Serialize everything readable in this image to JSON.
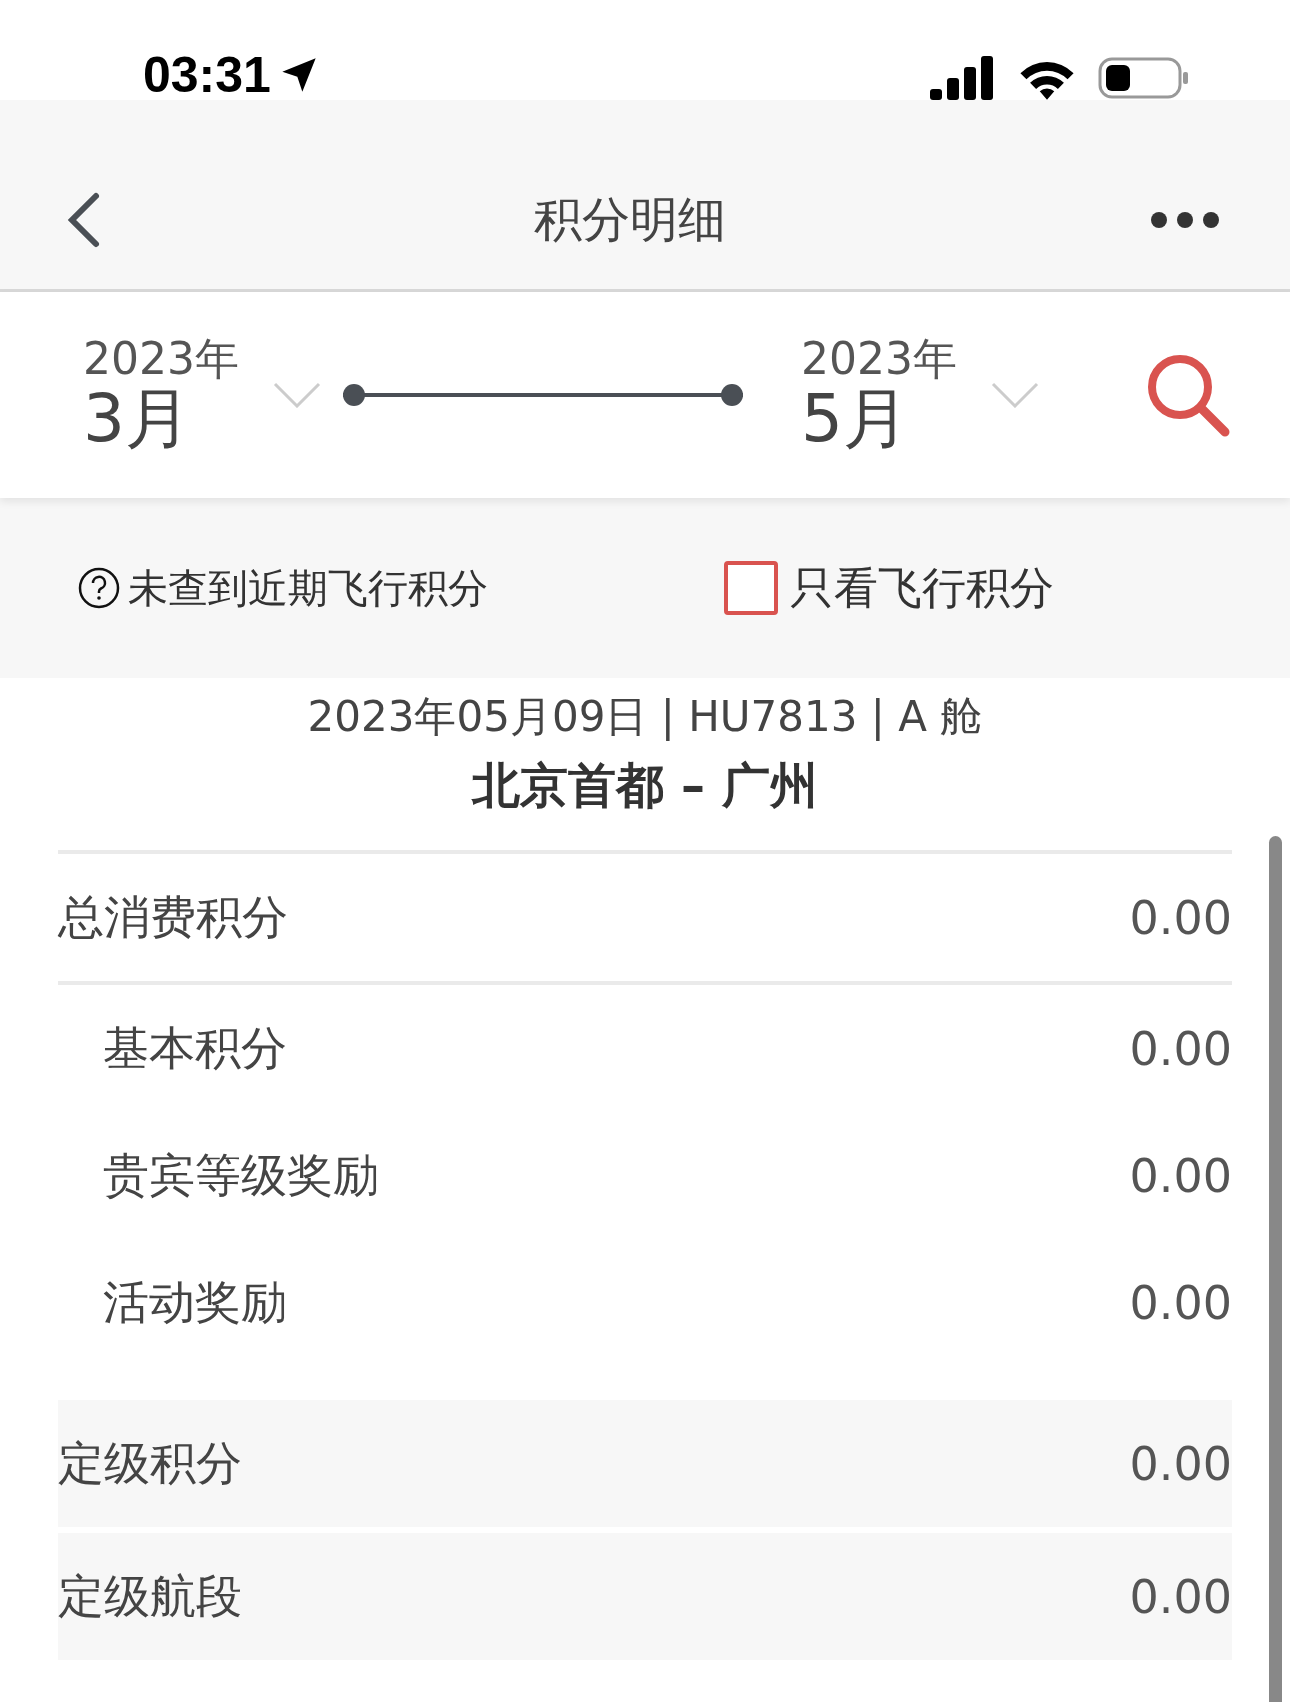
{
  "status_bar": {
    "time": "03:31"
  },
  "nav": {
    "title": "积分明细"
  },
  "date_range": {
    "start": {
      "year": "2023年",
      "month": "3月"
    },
    "end": {
      "year": "2023年",
      "month": "5月"
    }
  },
  "filters": {
    "hint": "未查到近期飞行积分",
    "checkbox": {
      "label": "只看飞行积分",
      "checked": false
    }
  },
  "flight": {
    "info": "2023年05月09日 | HU7813 | A 舱",
    "route": "北京首都 – 广州"
  },
  "rows": [
    {
      "kind": "total",
      "label": "总消费积分",
      "value": "0.00"
    },
    {
      "kind": "sub",
      "label": "基本积分",
      "value": "0.00"
    },
    {
      "kind": "sub",
      "label": "贵宾等级奖励",
      "value": "0.00"
    },
    {
      "kind": "sub",
      "label": "活动奖励",
      "value": "0.00"
    },
    {
      "kind": "grade",
      "label": "定级积分",
      "value": "0.00"
    },
    {
      "kind": "grade",
      "label": "定级航段",
      "value": "0.00"
    }
  ]
}
